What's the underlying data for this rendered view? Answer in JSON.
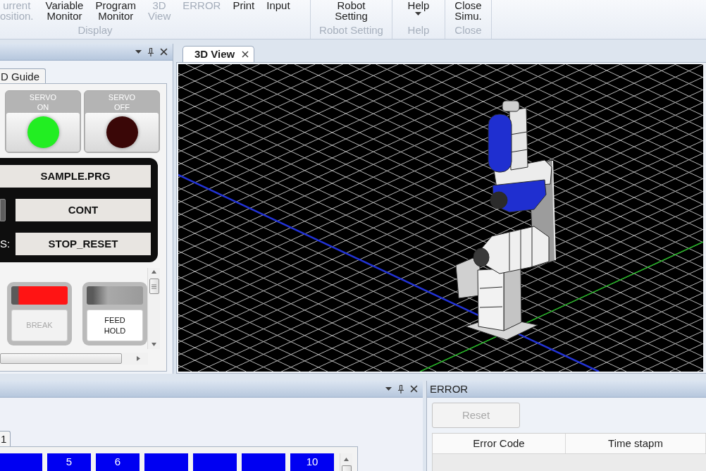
{
  "ribbon": {
    "groups": [
      {
        "label": "Display",
        "items": [
          {
            "label": "urrent osition.",
            "kind": "button",
            "disabled": true
          },
          {
            "label": "Variable Monitor",
            "kind": "button",
            "disabled": false
          },
          {
            "label": "Program Monitor",
            "kind": "button",
            "disabled": false
          },
          {
            "label": "3D View",
            "kind": "button",
            "disabled": true
          },
          {
            "label": "ERROR",
            "kind": "button",
            "disabled": true
          },
          {
            "label": "Print",
            "kind": "button",
            "disabled": false
          },
          {
            "label": "Input",
            "kind": "button",
            "disabled": false
          }
        ]
      },
      {
        "label": "Robot Setting",
        "items": [
          {
            "label": "Robot Setting",
            "kind": "button",
            "disabled": false
          }
        ]
      },
      {
        "label": "Help",
        "items": [
          {
            "label": "Help",
            "kind": "dropdown",
            "disabled": false
          }
        ]
      },
      {
        "label": "Close",
        "items": [
          {
            "label": "Close Simu.",
            "kind": "button",
            "disabled": false
          }
        ]
      }
    ]
  },
  "left_panel": {
    "tabs": [
      {
        "label": "D Guide",
        "selected": true
      }
    ],
    "servo_buttons": [
      {
        "label": "SERVO ON",
        "color": "#22ee22"
      },
      {
        "label": "SERVO OFF",
        "color": "#3a0707"
      }
    ],
    "program": "SAMPLE.PRG",
    "fields": [
      {
        "kind": "button",
        "value": "CONT"
      },
      {
        "kind": "label",
        "label": "S:",
        "value": "STOP_RESET"
      }
    ],
    "indicators": [
      {
        "label": "BREAK",
        "lit": true,
        "disabled": true
      },
      {
        "label": "FEED HOLD",
        "lit": false,
        "disabled": false
      }
    ]
  },
  "view_tabs": [
    {
      "label": "3D View",
      "selected": true
    }
  ],
  "bottom_panel": {
    "tabs": [
      {
        "label": "1",
        "selected": true
      }
    ],
    "cells": [
      {
        "kind": "blank"
      },
      {
        "kind": "numbered",
        "label": "5"
      },
      {
        "kind": "numbered",
        "label": "6"
      },
      {
        "kind": "blank"
      },
      {
        "kind": "blank"
      },
      {
        "kind": "blank"
      },
      {
        "kind": "numbered",
        "label": "10"
      }
    ]
  },
  "error_panel": {
    "title": "ERROR",
    "reset": {
      "label": "Reset",
      "disabled": true
    },
    "columns": [
      "Error Code",
      "Time stapm"
    ]
  }
}
